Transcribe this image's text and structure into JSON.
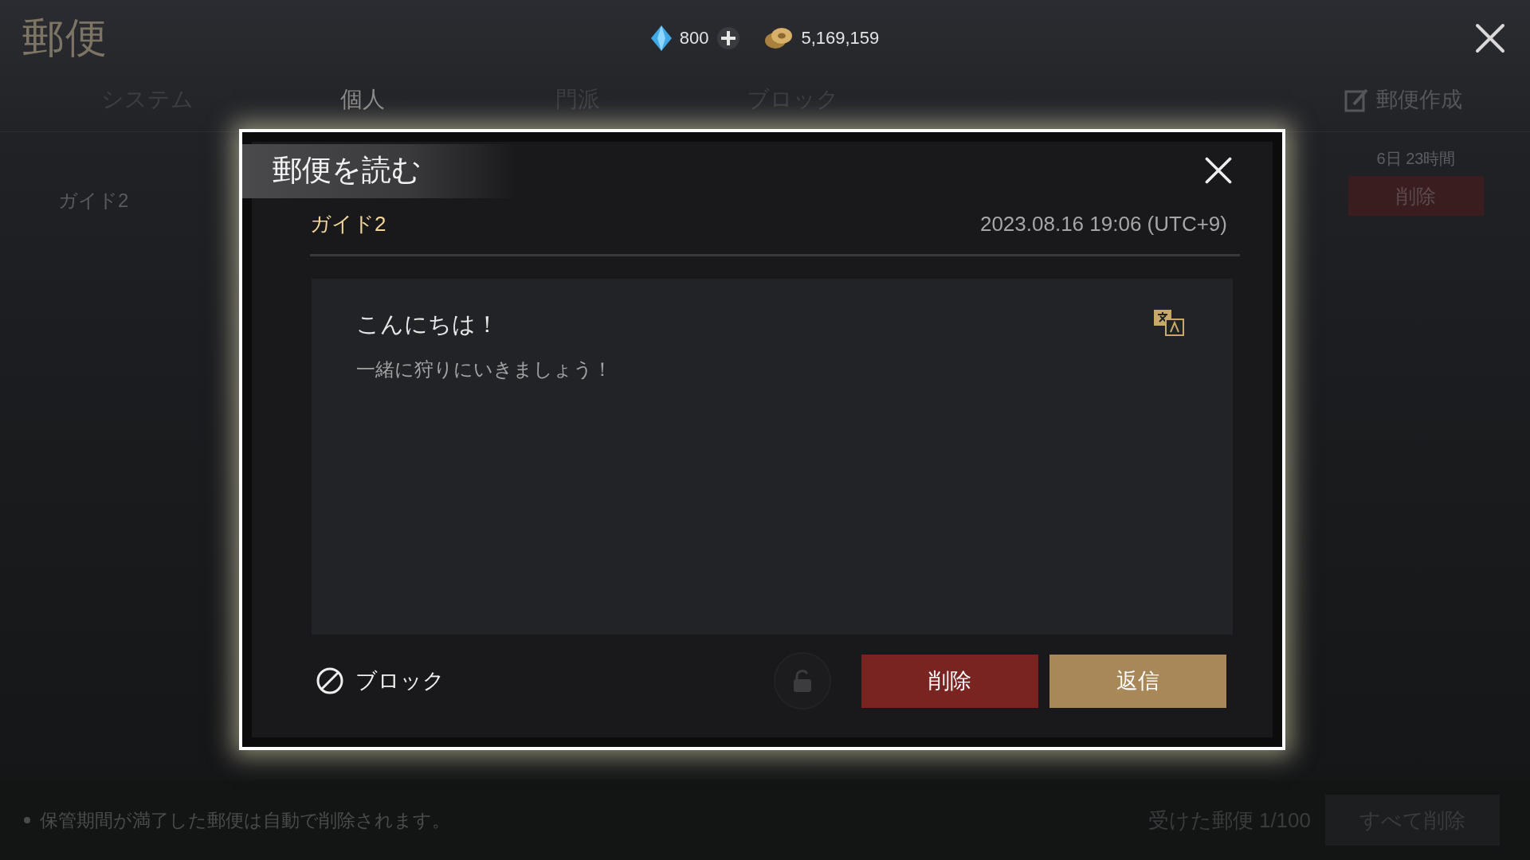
{
  "header": {
    "title": "郵便",
    "currencies": [
      {
        "kind": "gem",
        "amount": "800",
        "addable": true
      },
      {
        "kind": "coin",
        "amount": "5,169,159",
        "addable": false
      }
    ]
  },
  "tabs": [
    {
      "label": "システム",
      "selected": false
    },
    {
      "label": "個人",
      "selected": true
    },
    {
      "label": "門派",
      "selected": false
    },
    {
      "label": "ブロック",
      "selected": false
    }
  ],
  "compose_button": "郵便作成",
  "mail_list": [
    {
      "sender": "ガイド2",
      "expires": "6日 23時間",
      "delete_label": "削除"
    }
  ],
  "footer": {
    "note": "保管期間が満了した郵便は自動で削除されます。",
    "count_label": "受けた郵便",
    "count": "1/100",
    "delete_all": "すべて削除"
  },
  "dialog": {
    "title": "郵便を読む",
    "sender": "ガイド2",
    "date": "2023.08.16 19:06 (UTC+9)",
    "subject": "こんにちは！",
    "body": "一緒に狩りにいきましょう！",
    "block_label": "ブロック",
    "locked": false,
    "buttons": [
      {
        "kind": "danger",
        "label": "削除"
      },
      {
        "kind": "primary",
        "label": "返信"
      }
    ]
  }
}
